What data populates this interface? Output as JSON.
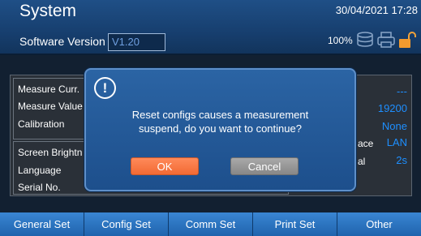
{
  "header": {
    "title": "System",
    "software_version_label": "Software Version",
    "software_version_value": "V1.20",
    "datetime": "30/04/2021 17:28",
    "battery_percent": "100%",
    "icons": [
      "database-icon",
      "printer-icon",
      "unlocked-lock-icon"
    ]
  },
  "panel": {
    "group1": {
      "labels": [
        "Measure Curr.",
        "Measure Value",
        "Calibration"
      ],
      "values": [
        "---",
        "19200",
        "None"
      ]
    },
    "group2": {
      "labels": [
        "Screen Brightn",
        "Language",
        "Serial No."
      ],
      "partial_labels": [
        "ace",
        "al"
      ],
      "values": [
        "LAN",
        "2s"
      ]
    }
  },
  "dialog": {
    "message_line1": "Reset configs causes a measurement",
    "message_line2": "suspend, do you want to continue?",
    "ok_label": "OK",
    "cancel_label": "Cancel"
  },
  "tabs": [
    "General Set",
    "Config Set",
    "Comm Set",
    "Print Set",
    "Other"
  ],
  "colors": {
    "accent_blue": "#1e8fff",
    "ok_button": "#f26a33",
    "header": "#1f4f86"
  }
}
